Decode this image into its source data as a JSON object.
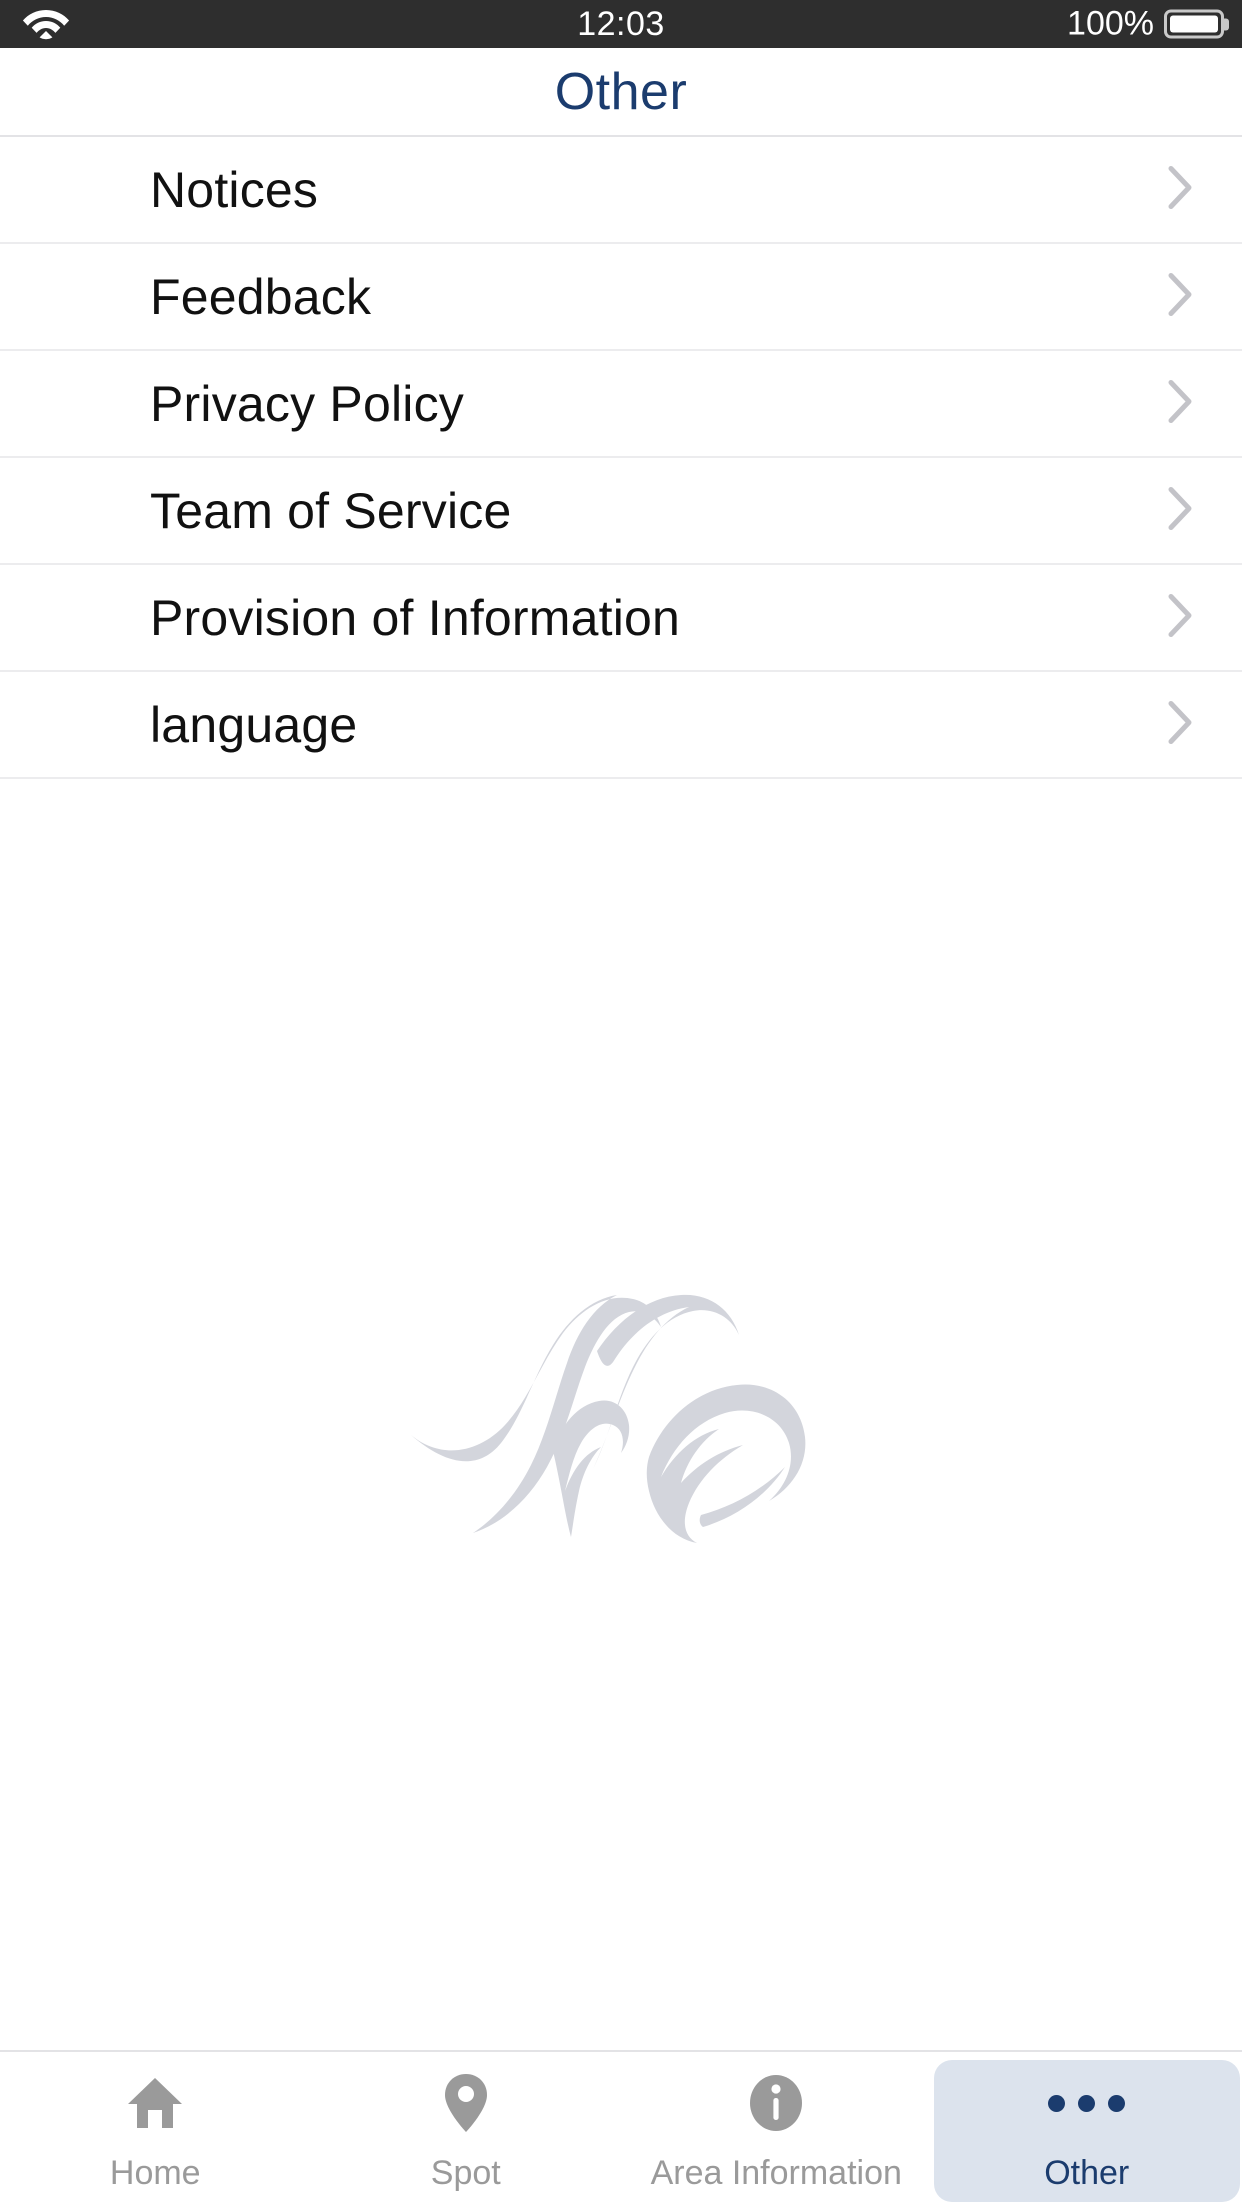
{
  "status_bar": {
    "wifi_icon": "wifi-icon",
    "time": "12:03",
    "battery_percent": "100%",
    "battery_icon": "battery-full-icon",
    "background_color": "#2e2e2e"
  },
  "header": {
    "title": "Other",
    "title_color": "#1b3c6e"
  },
  "list": {
    "chevron_icon": "chevron-right-icon",
    "items": [
      {
        "label": "Notices"
      },
      {
        "label": "Feedback"
      },
      {
        "label": "Privacy Policy"
      },
      {
        "label": "Team of Service"
      },
      {
        "label": "Provision of Information"
      },
      {
        "label": "language"
      }
    ]
  },
  "watermark": {
    "name": "app-logo-watermark",
    "color": "#d3d5dc"
  },
  "tabbar": {
    "active_background": "#dce3ed",
    "active_color": "#1b3c6e",
    "inactive_color": "#9a9a9a",
    "tabs": [
      {
        "label": "Home",
        "icon": "home-icon",
        "active": false
      },
      {
        "label": "Spot",
        "icon": "map-pin-icon",
        "active": false
      },
      {
        "label": "Area Information",
        "icon": "info-circle-icon",
        "active": false
      },
      {
        "label": "Other",
        "icon": "ellipsis-icon",
        "active": true
      }
    ]
  }
}
